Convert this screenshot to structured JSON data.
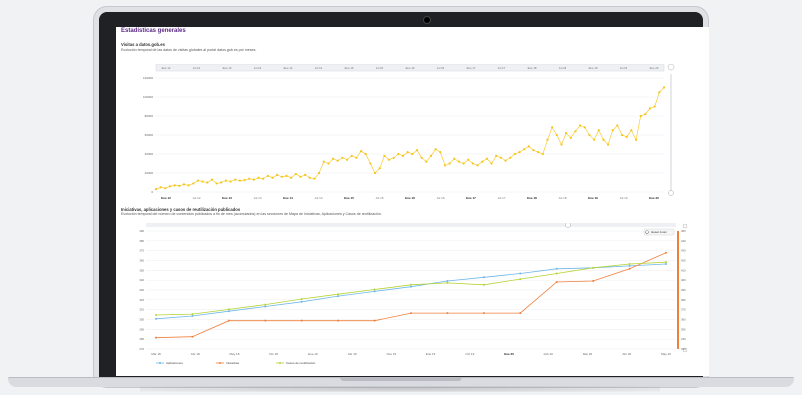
{
  "page": {
    "title": "Estadísticas generales"
  },
  "section1": {
    "title": "Visitas a datos.gob.es",
    "description": "Evolución temporal de las datos de visitas globales al portal datos.gob.es por meses."
  },
  "section2": {
    "title": "Iniciativas, aplicaciones y casos de reutilización publicados",
    "description": "Evolución temporal del número de contenidos publicados a fin de mes (acumulados) en las secciones de Mapa de Iniciativas, Aplicaciones y Casos de reutilización.",
    "reset_zoom_label": "Reset zoom"
  },
  "colors": {
    "visits": "#f5c518",
    "aplicaciones": "#6fb7e9",
    "iniciativas": "#f07f3c",
    "casos": "#b5d334",
    "title": "#5b2a86"
  },
  "chart_data": [
    {
      "type": "line",
      "xlabel": "",
      "ylabel": "",
      "ylim": [
        0,
        120000
      ],
      "y_ticks": [
        "0",
        "20000",
        "40000",
        "60000",
        "80000",
        "100000",
        "120000"
      ],
      "x_ticks": [
        "Ene 12",
        "Jul 12",
        "Ene 13",
        "Jul 13",
        "Ene 14",
        "Jul 14",
        "Ene 15",
        "Jul 15",
        "Ene 16",
        "Jul 16",
        "Ene 17",
        "Jul 17",
        "Ene 18",
        "Jul 18",
        "Ene 19",
        "Jul 19",
        "Ene 20"
      ],
      "navigator_ticks": [
        "Ene 12",
        "Jul 12",
        "Ene 13",
        "Jul 13",
        "Ene 14",
        "Jul 14",
        "Ene 15",
        "Jul 15",
        "Ene 16",
        "Jul 16",
        "Ene 17",
        "Jul 17",
        "Ene 18",
        "Jul 18",
        "Ene 19",
        "Jul 19",
        "Ene 20"
      ],
      "series": [
        {
          "name": "Visitas",
          "values": [
            3000,
            5000,
            4000,
            6000,
            7000,
            6500,
            8000,
            7000,
            9000,
            12000,
            11000,
            10000,
            13000,
            9000,
            10000,
            12000,
            11000,
            13000,
            12000,
            12500,
            14000,
            13000,
            15000,
            14000,
            17000,
            15000,
            18000,
            16000,
            17000,
            15000,
            19000,
            16000,
            18000,
            15000,
            14000,
            20000,
            32000,
            30000,
            35000,
            33000,
            36000,
            34000,
            38000,
            36000,
            43000,
            40000,
            30000,
            20000,
            25000,
            38000,
            34000,
            36000,
            40000,
            38000,
            42000,
            40000,
            44000,
            36000,
            32000,
            38000,
            45000,
            42000,
            28000,
            30000,
            35000,
            32000,
            30000,
            34000,
            30000,
            28000,
            32000,
            35000,
            30000,
            38000,
            36000,
            33000,
            36000,
            40000,
            42000,
            45000,
            48000,
            44000,
            42000,
            40000,
            55000,
            68000,
            60000,
            50000,
            62000,
            57000,
            64000,
            70000,
            68000,
            60000,
            55000,
            65000,
            55000,
            50000,
            65000,
            70000,
            60000,
            58000,
            65000,
            55000,
            80000,
            82000,
            88000,
            90000,
            105000,
            110000
          ]
        }
      ]
    },
    {
      "type": "line",
      "xlabel": "",
      "ylabel": "",
      "ylim": [
        270,
        395
      ],
      "y_ticks": [
        "270",
        "280",
        "290",
        "300",
        "310",
        "320",
        "330",
        "340",
        "350",
        "360",
        "370",
        "380",
        "390"
      ],
      "y2_ticks": [
        "330",
        "340",
        "350",
        "360",
        "370",
        "380",
        "390",
        "400",
        "410",
        "420",
        "430",
        "440",
        "450"
      ],
      "categories": [
        "Mar 18",
        "Abr 18",
        "May 18",
        "Dic 18",
        "Ene 19",
        "Abr 19",
        "Nov 19",
        "Ene 19",
        "Oct 19",
        "Dic 19",
        "Ene 20",
        "Feb 20",
        "Mar 20",
        "Abr 20",
        "May 20"
      ],
      "x_ticks": [
        "Mar 18",
        "Abr 18",
        "May 18",
        "Dic 18",
        "Ene 19",
        "Abr 19",
        "Nov 19",
        "Ene 19",
        "Oct 19",
        "Ene 20",
        "Feb 20",
        "Mar 20",
        "Abr 20",
        "May 20"
      ],
      "series": [
        {
          "name": "Aplicaciones",
          "values": [
            302,
            305,
            310,
            315,
            320,
            326,
            331,
            336,
            342,
            346,
            350,
            355,
            356,
            358,
            360
          ]
        },
        {
          "name": "Iniciativas",
          "values": [
            282,
            283,
            300,
            300,
            300,
            300,
            300,
            308,
            308,
            308,
            308,
            341,
            342,
            355,
            372
          ]
        },
        {
          "name": "Casos de reutilización",
          "values": [
            306,
            307,
            312,
            317,
            323,
            328,
            333,
            338,
            340,
            338,
            344,
            350,
            356,
            360,
            362
          ]
        }
      ],
      "legend": "bottom-left"
    }
  ]
}
